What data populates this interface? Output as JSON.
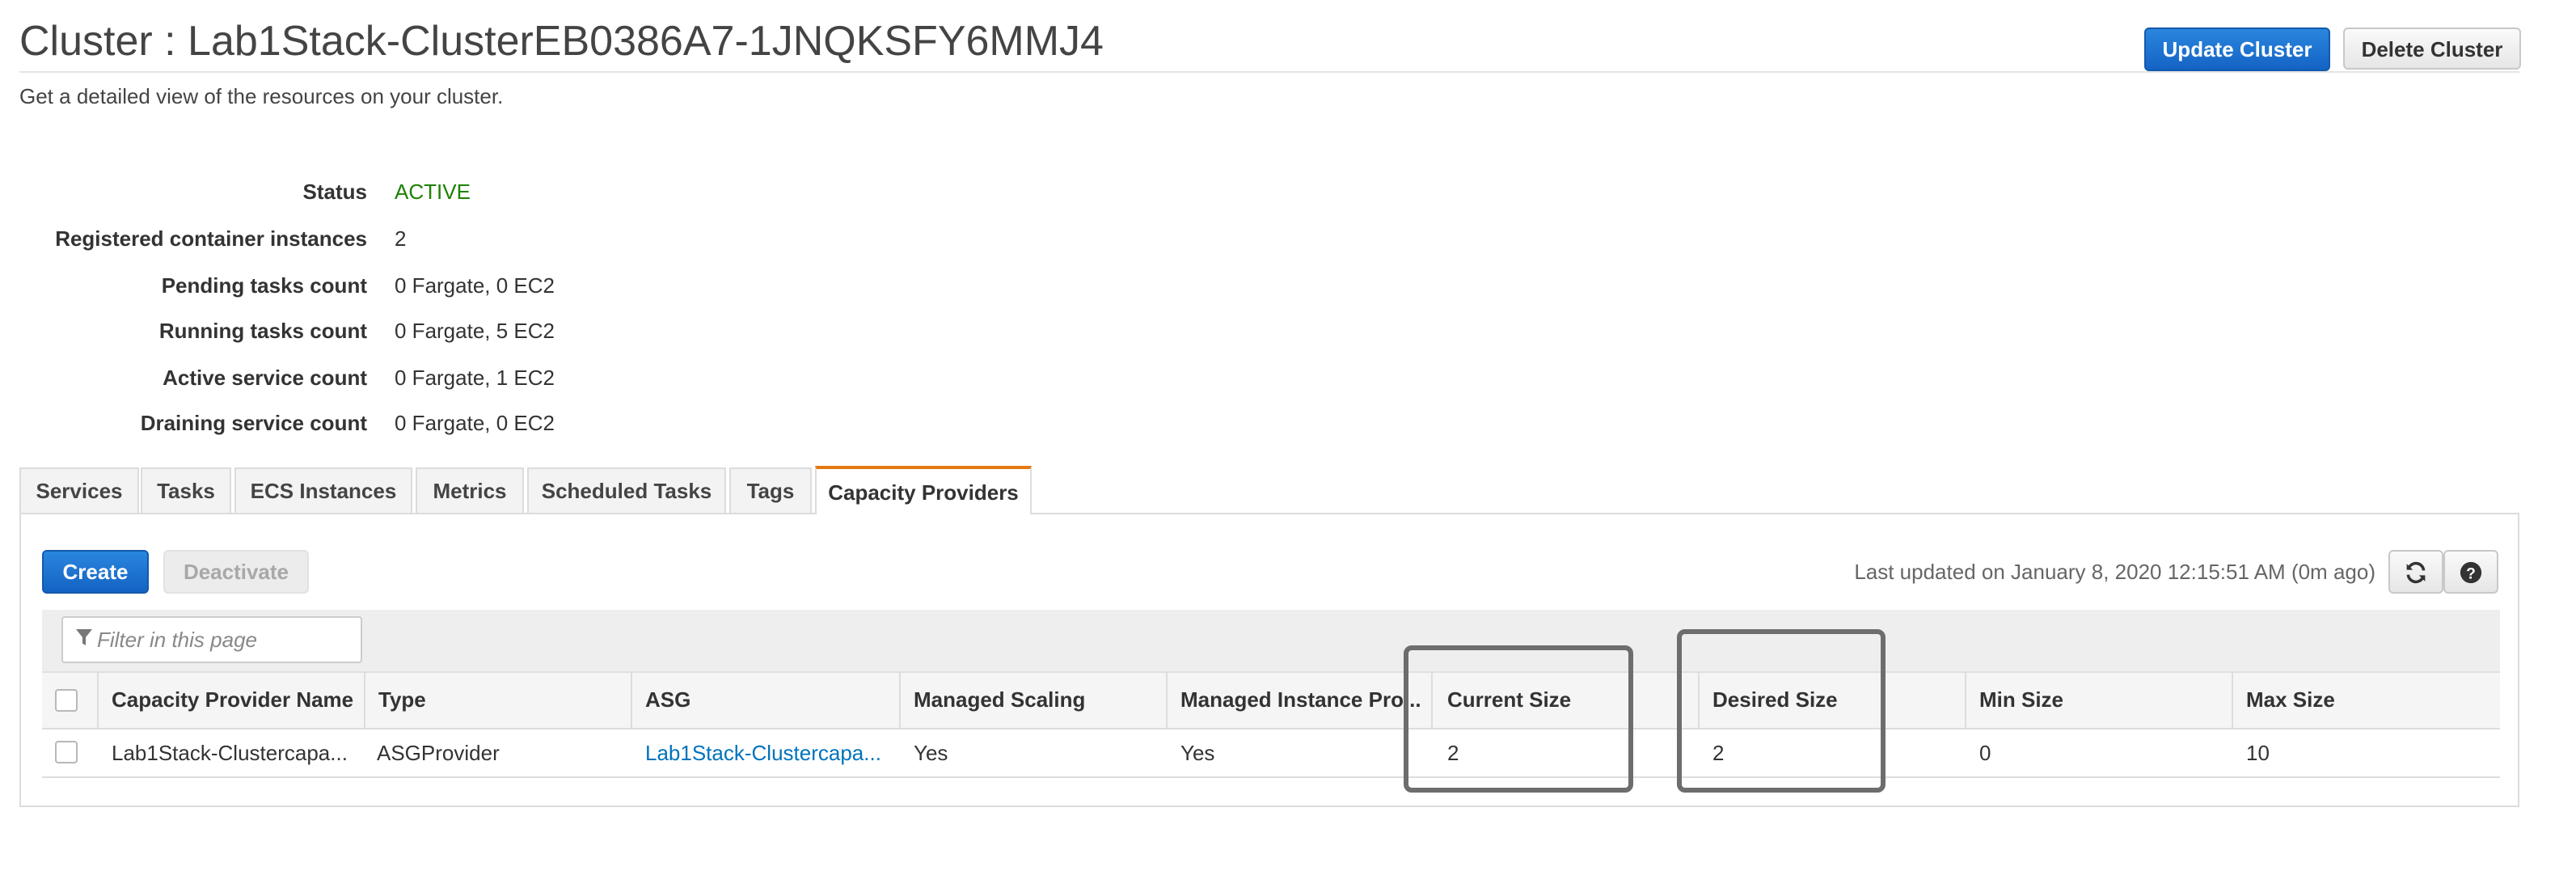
{
  "header": {
    "title": "Cluster : Lab1Stack-ClusterEB0386A7-1JNQKSFY6MMJ4",
    "subtitle": "Get a detailed view of the resources on your cluster.",
    "update_button": "Update Cluster",
    "delete_button": "Delete Cluster"
  },
  "details": [
    {
      "label": "Status",
      "value": "ACTIVE"
    },
    {
      "label": "Registered container instances",
      "value": "2"
    },
    {
      "label": "Pending tasks count",
      "value": "0 Fargate, 0 EC2"
    },
    {
      "label": "Running tasks count",
      "value": "0 Fargate, 5 EC2"
    },
    {
      "label": "Active service count",
      "value": "0 Fargate, 1 EC2"
    },
    {
      "label": "Draining service count",
      "value": "0 Fargate, 0 EC2"
    }
  ],
  "status_color": "#1d8102",
  "tabs": [
    {
      "label": "Services"
    },
    {
      "label": "Tasks"
    },
    {
      "label": "ECS Instances"
    },
    {
      "label": "Metrics"
    },
    {
      "label": "Scheduled Tasks"
    },
    {
      "label": "Tags"
    },
    {
      "label": "Capacity Providers",
      "active": true
    }
  ],
  "toolbar": {
    "create_button": "Create",
    "deactivate_button": "Deactivate",
    "last_updated": "Last updated on January 8, 2020 12:15:51 AM (0m ago)",
    "refresh_icon": "refresh-icon",
    "help_icon": "help-icon"
  },
  "filter": {
    "placeholder": "Filter in this page",
    "icon": "filter-icon"
  },
  "table": {
    "columns": [
      "Capacity Provider Name",
      "Type",
      "ASG",
      "Managed Scaling",
      "Managed Instance Pro...",
      "Current Size",
      "Desired Size",
      "Min Size",
      "Max Size"
    ],
    "rows": [
      {
        "name": "Lab1Stack-Clustercapa...",
        "type": "ASGProvider",
        "asg": "Lab1Stack-Clustercapa...",
        "managed_scaling": "Yes",
        "managed_instance_protection": "Yes",
        "current_size": "2",
        "desired_size": "2",
        "min_size": "0",
        "max_size": "10"
      }
    ]
  },
  "colors": {
    "primary": "#1463c4",
    "link": "#0073bb",
    "active_tab_accent": "#e47911"
  }
}
